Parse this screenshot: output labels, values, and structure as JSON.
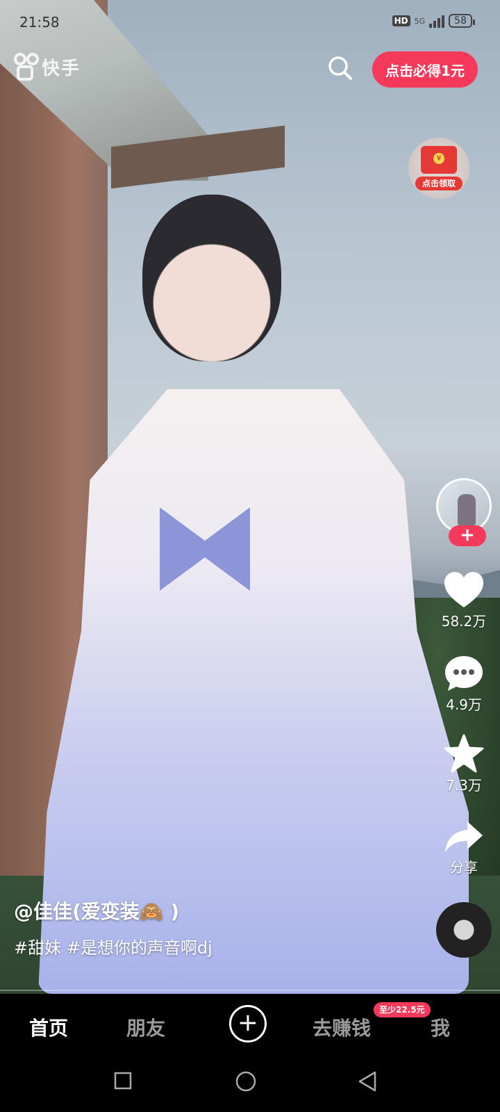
{
  "status_bar": {
    "time": "21:58",
    "hd_label": "HD",
    "network": "5G",
    "battery": "58"
  },
  "header": {
    "logo_text": "快手",
    "promo_button": "点击必得1元",
    "red_packet_label": "点击领取"
  },
  "side_actions": {
    "follow_symbol": "+",
    "likes": "58.2万",
    "comments": "4.9万",
    "favorites": "7.3万",
    "share": "分享"
  },
  "video": {
    "author": "@佳佳(爱变装🙈 )",
    "tags": "#甜妹 #是想你的声音啊dj"
  },
  "tab_bar": {
    "items": [
      "首页",
      "朋友",
      "去赚钱",
      "我"
    ],
    "active": "首页",
    "earn_badge": "至少22.5元"
  },
  "colors": {
    "accent": "#f5395a",
    "tab_active": "#ffffff",
    "tab_inactive": "#9a9a9a"
  }
}
